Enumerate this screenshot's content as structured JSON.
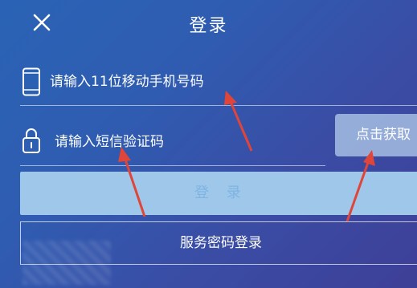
{
  "header": {
    "title": "登录"
  },
  "form": {
    "phone_placeholder": "请输入11位移动手机号码",
    "code_placeholder": "请输入短信验证码",
    "get_code_label": "点击获取",
    "login_label": "登 录",
    "password_login_label": "服务密码登录"
  },
  "icons": {
    "close": "close-icon",
    "phone": "phone-icon",
    "lock": "lock-icon"
  },
  "colors": {
    "arrow": "#e0453a",
    "login_button_bg": "#9ec7ea"
  }
}
